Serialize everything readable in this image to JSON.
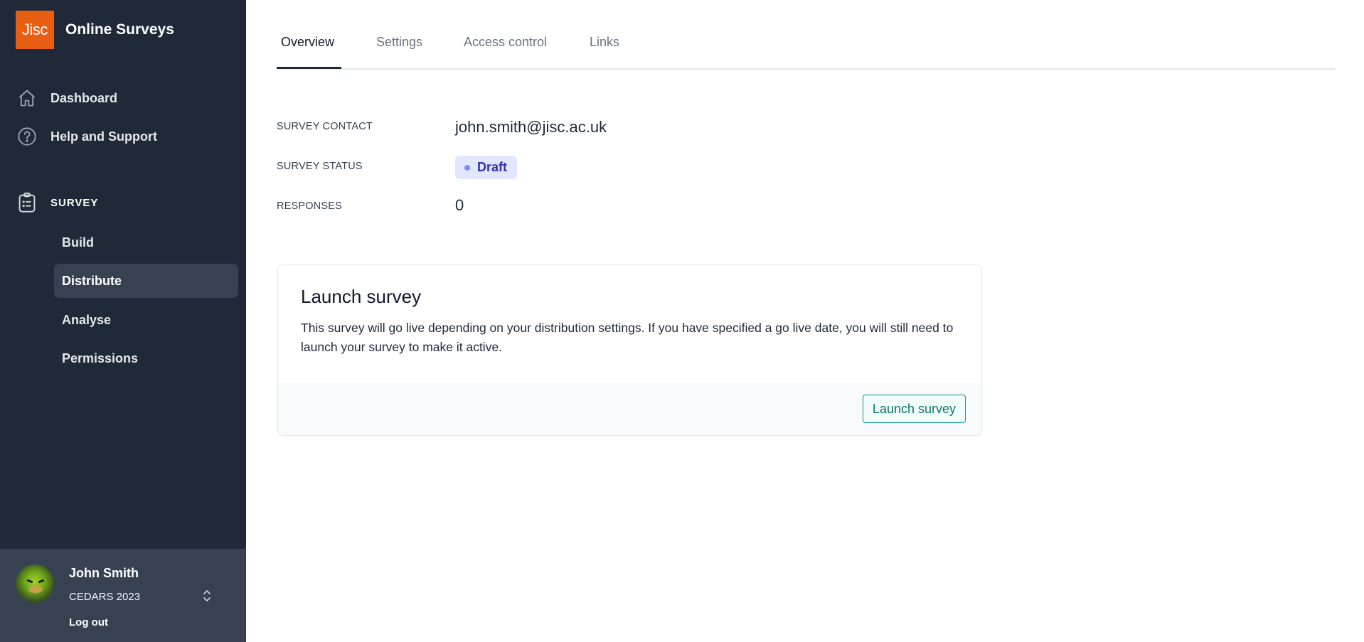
{
  "app": {
    "logo_text": "Jisc",
    "title": "Online Surveys",
    "brand_color": "#e85e13"
  },
  "sidebar": {
    "nav": [
      {
        "label": "Dashboard",
        "icon": "home-icon"
      },
      {
        "label": "Help and Support",
        "icon": "question-circle-icon"
      }
    ],
    "section": {
      "label": "SURVEY",
      "icon": "clipboard-list-icon"
    },
    "sub_items": [
      {
        "label": "Build",
        "active": false
      },
      {
        "label": "Distribute",
        "active": true
      },
      {
        "label": "Analyse",
        "active": false
      },
      {
        "label": "Permissions",
        "active": false
      }
    ],
    "user": {
      "name": "John Smith",
      "organisation": "CEDARS 2023",
      "logout_label": "Log out",
      "switcher_icon": "chevron-up-down-icon"
    }
  },
  "tabs": [
    {
      "label": "Overview",
      "active": true
    },
    {
      "label": "Settings",
      "active": false
    },
    {
      "label": "Access control",
      "active": false
    },
    {
      "label": "Links",
      "active": false
    }
  ],
  "overview": {
    "contact_label": "SURVEY CONTACT",
    "contact_value": "john.smith@jisc.ac.uk",
    "status_label": "SURVEY STATUS",
    "status_value": "Draft",
    "status_color": "#3730a3",
    "responses_label": "RESPONSES",
    "responses_value": "0"
  },
  "launch_card": {
    "title": "Launch survey",
    "body": "This survey will go live depending on your distribution settings. If you have specified a go live date, you will still need to launch your survey to make it active.",
    "button_label": "Launch survey",
    "button_color": "#0f766e"
  }
}
